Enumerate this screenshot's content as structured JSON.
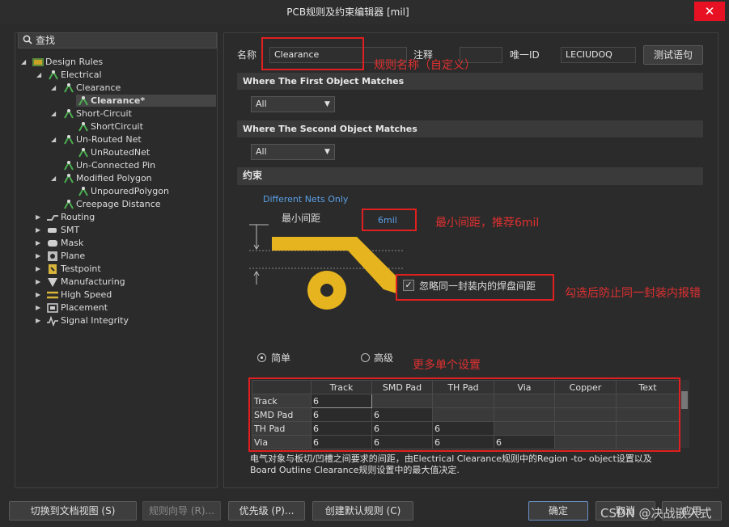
{
  "window": {
    "title": "PCB规则及约束编辑器 [mil]",
    "close_glyph": "✕"
  },
  "search": {
    "label": "查找"
  },
  "tree": {
    "design_rules": "Design Rules",
    "electrical": "Electrical",
    "clearance": "Clearance",
    "clearance_rule": "Clearance*",
    "short_circuit": "Short-Circuit",
    "short_circuit_rule": "ShortCircuit",
    "unrouted_net": "Un-Routed Net",
    "unrouted_net_rule": "UnRoutedNet",
    "unconnected_pin": "Un-Connected Pin",
    "modified_polygon": "Modified Polygon",
    "unpoured_polygon": "UnpouredPolygon",
    "creepage_distance": "Creepage Distance",
    "routing": "Routing",
    "smt": "SMT",
    "mask": "Mask",
    "plane": "Plane",
    "testpoint": "Testpoint",
    "manufacturing": "Manufacturing",
    "high_speed": "High Speed",
    "placement": "Placement",
    "signal_integrity": "Signal Integrity"
  },
  "rule": {
    "name_label": "名称",
    "name_value": "Clearance",
    "comment_label": "注释",
    "comment_value": "",
    "uid_label": "唯一ID",
    "uid_value": "LECIUDOQ",
    "test_button": "测试语句"
  },
  "first_match": {
    "header": "Where The First Object Matches",
    "value": "All"
  },
  "second_match": {
    "header": "Where The Second Object Matches",
    "value": "All"
  },
  "constraints": {
    "header": "约束",
    "net_scope": "Different Nets Only",
    "min_clearance_label": "最小间距",
    "min_clearance_value": "6mil",
    "ignore_pad_label": "忽略同一封装内的焊盘间距",
    "ignore_pad_checked": true,
    "mode_simple": "简单",
    "mode_advanced": "高级",
    "mode_selected": "simple"
  },
  "matrix": {
    "columns": [
      "",
      "Track",
      "SMD Pad",
      "TH Pad",
      "Via",
      "Copper",
      "Text"
    ],
    "rows": [
      {
        "label": "Track",
        "cells": [
          "6",
          "",
          "",
          "",
          "",
          ""
        ]
      },
      {
        "label": "SMD Pad",
        "cells": [
          "6",
          "6",
          "",
          "",
          "",
          ""
        ]
      },
      {
        "label": "TH Pad",
        "cells": [
          "6",
          "6",
          "6",
          "",
          "",
          ""
        ]
      },
      {
        "label": "Via",
        "cells": [
          "6",
          "6",
          "6",
          "6",
          "",
          ""
        ]
      }
    ]
  },
  "description": {
    "line1": "电气对象与板切/凹槽之间要求的间距，由Electrical Clearance规则中的Region -to- object设置以及",
    "line2": "Board Outline Clearance规则设置中的最大值决定."
  },
  "annotations": {
    "rule_name_note": "规则名称（自定义）",
    "min_clearance_note": "最小间距，推荐6mil",
    "ignore_pad_note": "勾选后防止同一封装内报错",
    "more_settings_note": "更多单个设置"
  },
  "buttons": {
    "switch_doc_view": "切换到文档视图 (S)",
    "rule_wizard": "规则向导 (R)...",
    "priority": "优先级 (P)...",
    "create_default": "创建默认规则 (C)",
    "ok": "确定",
    "cancel": "取消",
    "apply": "应用"
  },
  "watermark": "CSDN @决战嵌入式",
  "colors": {
    "annotation_red": "#e02020",
    "trace_gold": "#e6b41e",
    "accent_blue": "#5aa0e6"
  }
}
